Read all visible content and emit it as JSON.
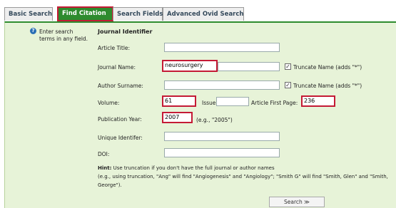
{
  "tabs": [
    {
      "label": "Basic Search",
      "active": false
    },
    {
      "label": "Find Citation",
      "active": true
    },
    {
      "label": "Search Fields",
      "active": false
    },
    {
      "label": "Advanced Ovid Search",
      "active": false
    }
  ],
  "instruction": {
    "line1": "Enter search",
    "line2": "terms in any field."
  },
  "section_title": "Journal Identifier",
  "fields": {
    "article_title": {
      "label": "Article Title:",
      "value": ""
    },
    "journal_name": {
      "label": "Journal Name:",
      "value": "neurosurgery"
    },
    "author_surname": {
      "label": "Author Surname:",
      "value": ""
    },
    "volume": {
      "label": "Volume:",
      "value": "61"
    },
    "issue": {
      "label": "Issue:",
      "value": ""
    },
    "article_first_page": {
      "label": "Article First Page:",
      "value": "236"
    },
    "publication_year": {
      "label": "Publication Year:",
      "value": "2007",
      "example": "(e.g., \"2005\")"
    },
    "unique_identifier": {
      "label": "Unique Identifer:",
      "value": ""
    },
    "doi": {
      "label": "DOI:",
      "value": ""
    }
  },
  "truncate_label": "Truncate Name (adds \"*\")",
  "truncate_check": "✓",
  "hint": {
    "title": "Hint:",
    "text": "Use truncation if you don't have the full journal or author names",
    "line2": "(e.g., using truncation, \"Ang\" will find \"Angiogenesis\" and \"Angiology\"; \"Smith G\" will find \"Smith, Glen\" and \"Smith,",
    "line3": "George\")."
  },
  "search_button": "Search ≫",
  "colors": {
    "active_tab": "#2e8b2e",
    "highlight": "#c41a35",
    "panel_bg": "#e7f3d8"
  }
}
